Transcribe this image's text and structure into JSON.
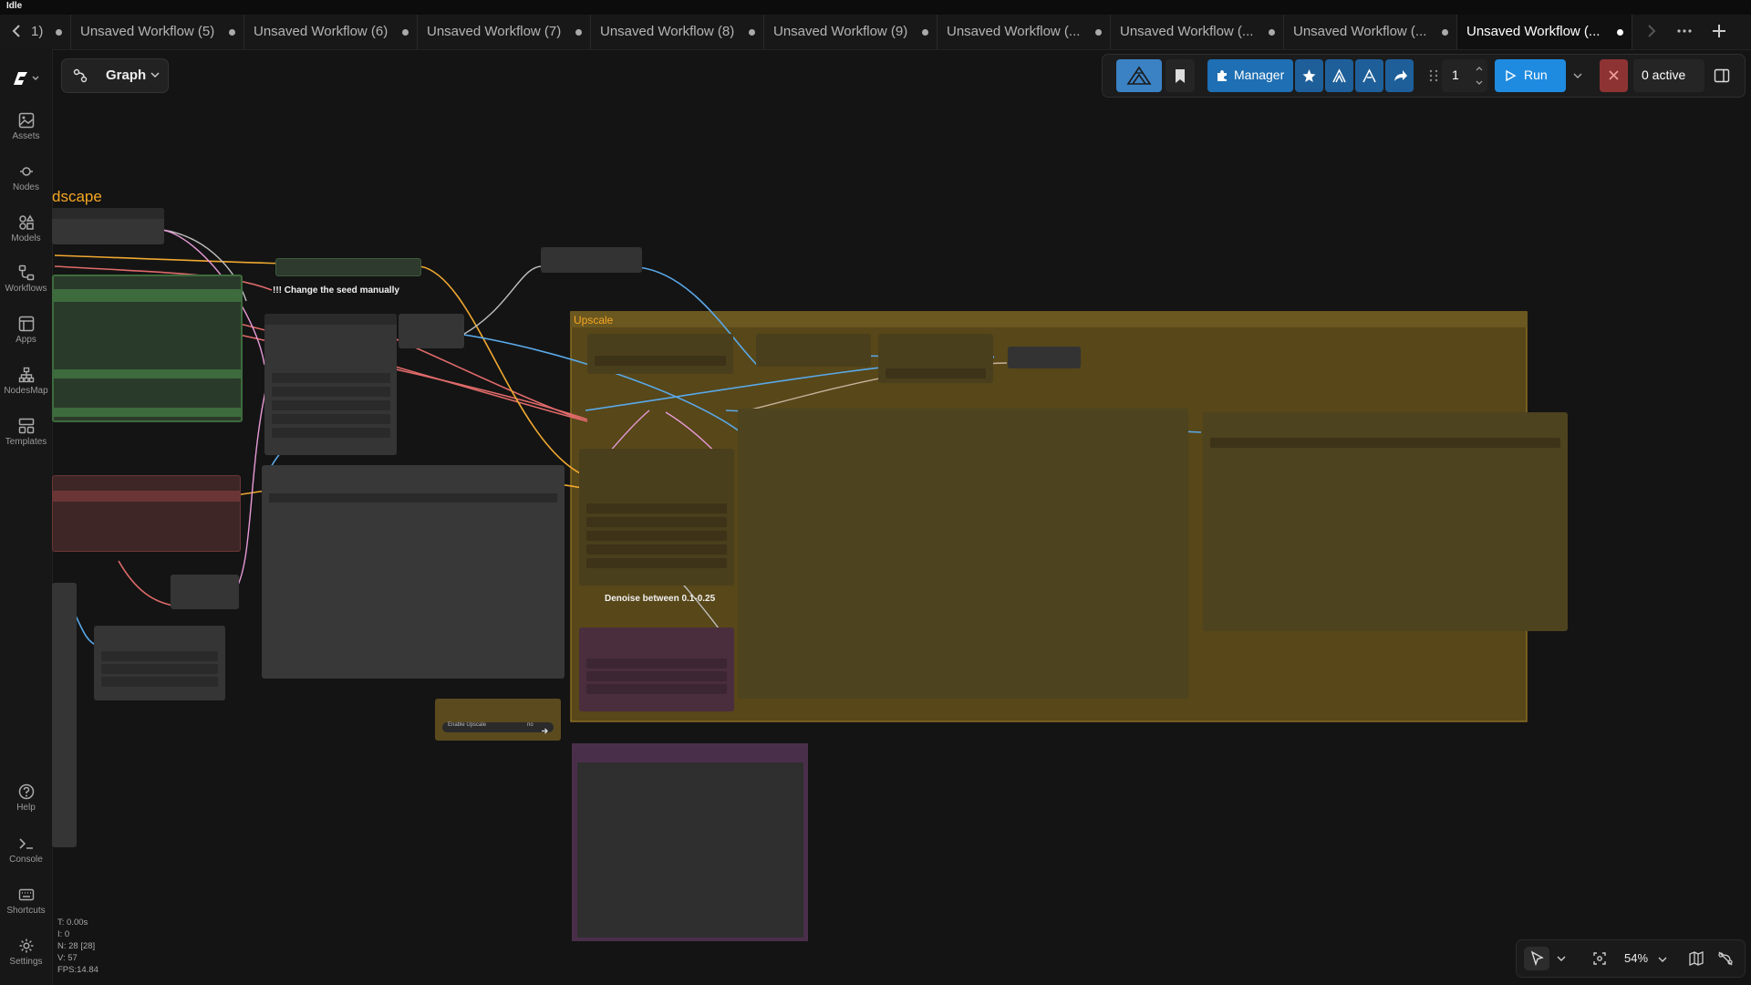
{
  "status": {
    "title": "Idle"
  },
  "tabs": [
    {
      "label": "1)"
    },
    {
      "label": "Unsaved Workflow (5)"
    },
    {
      "label": "Unsaved Workflow (6)"
    },
    {
      "label": "Unsaved Workflow (7)"
    },
    {
      "label": "Unsaved Workflow (8)"
    },
    {
      "label": "Unsaved Workflow (9)"
    },
    {
      "label": "Unsaved Workflow (..."
    },
    {
      "label": "Unsaved Workflow (..."
    },
    {
      "label": "Unsaved Workflow (..."
    },
    {
      "label": "Unsaved Workflow (...",
      "active": true
    }
  ],
  "sidebar": {
    "items": [
      {
        "label": "Assets",
        "icon": "image-icon"
      },
      {
        "label": "Nodes",
        "icon": "nodes-icon"
      },
      {
        "label": "Models",
        "icon": "models-icon"
      },
      {
        "label": "Workflows",
        "icon": "workflows-icon"
      },
      {
        "label": "Apps",
        "icon": "apps-icon"
      },
      {
        "label": "NodesMap",
        "icon": "sitemap-icon"
      },
      {
        "label": "Templates",
        "icon": "templates-icon"
      }
    ],
    "bottom": [
      {
        "label": "Help",
        "icon": "help-icon"
      },
      {
        "label": "Console",
        "icon": "terminal-icon"
      },
      {
        "label": "Shortcuts",
        "icon": "keyboard-icon"
      },
      {
        "label": "Settings",
        "icon": "gear-icon"
      }
    ]
  },
  "toolbar": {
    "graph_label": "Graph",
    "manager_label": "Manager",
    "batch_count": "1",
    "run_label": "Run",
    "active_label": "0 active"
  },
  "canvas": {
    "group_landscape_title": "dscape",
    "group_upscale_title": "Upscale",
    "note_seed": "!!! Change the seed manually",
    "note_denoise": "Denoise between 0.1-0.25",
    "enable_upscale_label": "Enable Upscale",
    "enable_upscale_value": "no"
  },
  "stats": {
    "t": "T: 0.00s",
    "i": "I: 0",
    "n": "N: 28 [28]",
    "v": "V: 57",
    "fps": "FPS:14.84"
  },
  "zoom": {
    "label": "54%"
  },
  "colors": {
    "run": "#1f8be0",
    "manager": "#1e6fb3",
    "stop": "#8e3333",
    "upscale_group": "#5b4a1c"
  }
}
